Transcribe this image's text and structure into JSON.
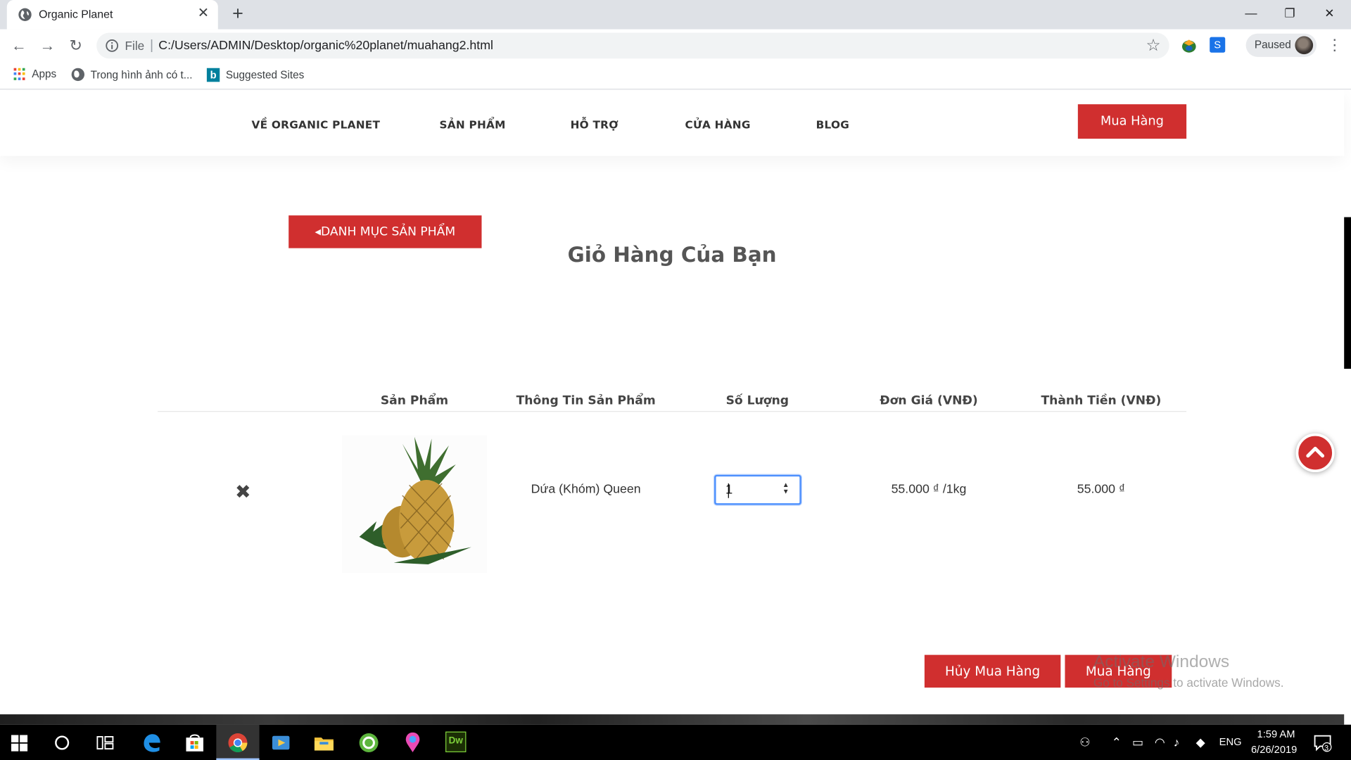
{
  "browser": {
    "tab_title": "Organic Planet",
    "tab_close": "✕",
    "new_tab": "+",
    "window_controls": {
      "minimize": "—",
      "maximize": "❐",
      "close": "✕"
    },
    "url_scheme": "File",
    "url_sep": "|",
    "url": "C:/Users/ADMIN/Desktop/organic%20planet/muahang2.html",
    "star": "☆",
    "profile_status": "Paused",
    "menu": "⋮",
    "nav": {
      "back": "←",
      "forward": "→",
      "reload": "↻"
    },
    "bookmarks": [
      "Apps",
      "Trong hình ảnh có t...",
      "Suggested Sites"
    ]
  },
  "site": {
    "nav": [
      "VỀ ORGANIC PLANET",
      "SẢN PHẨM",
      "HỖ TRỢ",
      "CỬA HÀNG",
      "BLOG"
    ],
    "header_button": "Mua Hàng",
    "catalog_button": "DANH MỤC SẢN PHẨM",
    "cart_title": "Giỏ Hàng Của Bạn",
    "table_headers": [
      "Sản Phẩm",
      "Thông Tin Sản Phẩm",
      "Số Lượng",
      "Đơn Giá (VNĐ)",
      "Thành Tiền (VNĐ)"
    ],
    "row": {
      "remove": "✖",
      "product_name": "Dứa (Khóm) Queen",
      "quantity": "1",
      "unit_price": "55.000 ₫ /1kg",
      "total": "55.000 ₫"
    },
    "cancel_button": "Hủy Mua Hàng",
    "buy_button": "Mua Hàng",
    "watermark_title": "Activate Windows",
    "watermark_sub": "Go to Settings to activate Windows."
  },
  "taskbar": {
    "language": "ENG",
    "time": "1:59 AM",
    "date": "6/26/2019",
    "notifications": "3",
    "apps": [
      "windows-start",
      "cortana",
      "task-view",
      "edge",
      "store",
      "chrome",
      "media-player",
      "file-explorer",
      "corel",
      "maps",
      "dreamweaver"
    ]
  },
  "colors": {
    "accent_red": "#d02f2f",
    "focus_blue": "#4d90fe",
    "chrome_tabstrip": "#dee1e6",
    "taskbar": "#000000"
  }
}
